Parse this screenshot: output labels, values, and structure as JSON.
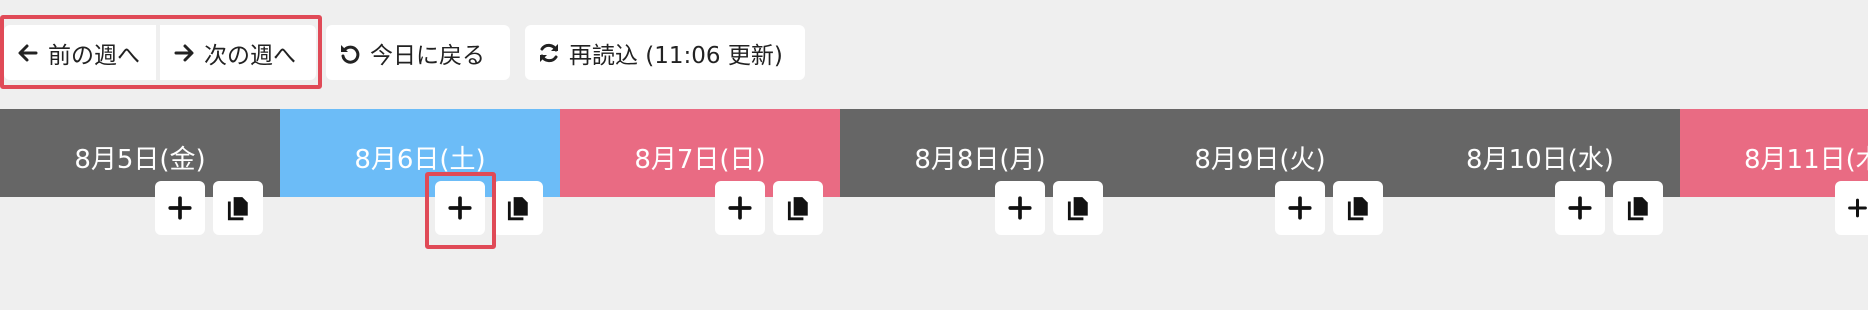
{
  "toolbar": {
    "prev_week_label": "前の週へ",
    "next_week_label": "次の週へ",
    "today_label": "今日に戻る",
    "reload_label": "再読込 (11:06 更新)"
  },
  "days": [
    {
      "label": "8月5日(金)",
      "color": "gray"
    },
    {
      "label": "8月6日(土)",
      "color": "blue"
    },
    {
      "label": "8月7日(日)",
      "color": "pink"
    },
    {
      "label": "8月8日(月)",
      "color": "gray"
    },
    {
      "label": "8月9日(火)",
      "color": "gray"
    },
    {
      "label": "8月10日(水)",
      "color": "gray"
    },
    {
      "label": "8月11日(木",
      "color": "pink"
    }
  ],
  "colors": {
    "weekday": "#666666",
    "saturday": "#6cbcf7",
    "sunday": "#e96b83",
    "highlight": "#e04a57"
  },
  "icons": {
    "prev": "arrow-left-icon",
    "next": "arrow-right-icon",
    "today": "undo-icon",
    "reload": "refresh-icon",
    "add": "plus-icon",
    "copy": "copy-icon"
  }
}
